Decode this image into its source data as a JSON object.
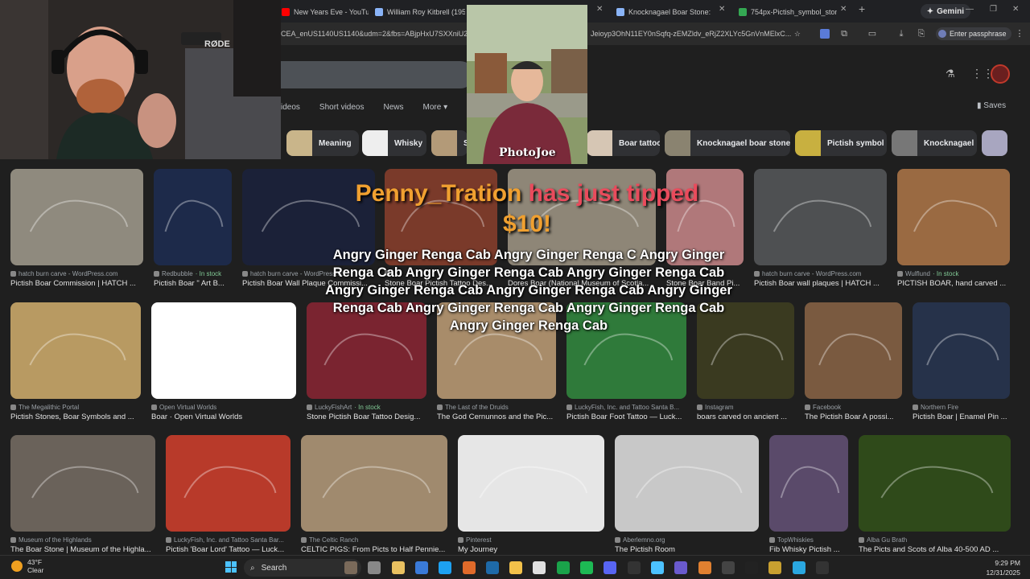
{
  "browser": {
    "tabs": [
      {
        "label": "New Years Eve - YouTub",
        "color": "#ff0000"
      },
      {
        "label": "William Roy Kitbrell (1959-2",
        "color": "#8ab4f8"
      },
      {
        "label": "Knocknagael Boar Stone: His",
        "color": "#8ab4f8"
      },
      {
        "label": "754px-Pictish_symbol_stone_",
        "color": "#34a853"
      }
    ],
    "gemini_label": "Gemini",
    "url": "CEA_enUS1140US1140&udm=2&fbs=ABjpHxU7SXXniU2",
    "url_tail": "Jeioyp3OhN11EY0nSqfq-zEMZldv_eRjZ2XLYc5GnVnMElxC...",
    "passphrase_label": "Enter passphrase"
  },
  "search": {
    "filters": [
      "ideos",
      "Short videos",
      "News",
      "More"
    ],
    "saves_label": "Saves",
    "chips": [
      {
        "label": "Meaning",
        "color": "#c9b58a"
      },
      {
        "label": "Whisky",
        "color": "#eee"
      },
      {
        "label": "S",
        "color": "#b39a78"
      },
      {
        "label": "Boar tattoo",
        "color": "#d6c6b4"
      },
      {
        "label": "Knocknagael boar stone",
        "color": "#8a8370"
      },
      {
        "label": "Pictish symbol",
        "color": "#c8b040"
      },
      {
        "label": "Knocknagael",
        "color": "#777"
      }
    ]
  },
  "results": [
    {
      "source": "hatch burn carve - WordPress.com",
      "title": "Pictish Boar Commission | HATCH ...",
      "color": "#8f8a7e",
      "stock": ""
    },
    {
      "source": "Redbubble",
      "title": "Pictish Boar \" Art B...",
      "color": "#1d2a4a",
      "stock": "In stock"
    },
    {
      "source": "hatch burn carve - WordPress.com",
      "title": "Pictish Boar Wall Plaque Commissi...",
      "color": "#1b2138",
      "stock": ""
    },
    {
      "source": "",
      "title": "Stone Boar Pictish Tattoo Des...",
      "color": "#7a3a2a",
      "stock": ""
    },
    {
      "source": "",
      "title": "Dores Boar (National Museum of Scotla...",
      "color": "#8e8677",
      "stock": ""
    },
    {
      "source": "",
      "title": "Stone Boar Band Pi...",
      "color": "#b0787a",
      "stock": ""
    },
    {
      "source": "hatch burn carve - WordPress.com",
      "title": "Pictish Boar wall plaques | HATCH ...",
      "color": "#4e5052",
      "stock": ""
    },
    {
      "source": "Wulflund",
      "title": "PICTISH BOAR, hand carved ...",
      "color": "#9a6a42",
      "stock": "In stock"
    },
    {
      "source": "The Megalithic Portal",
      "title": "Pictish Stones, Boar Symbols and ...",
      "color": "#b89a62",
      "stock": ""
    },
    {
      "source": "Open Virtual Worlds",
      "title": "Boar · Open Virtual Worlds",
      "color": "#ffffff",
      "stock": ""
    },
    {
      "source": "LuckyFishArt",
      "title": "Stone Pictish Boar Tattoo Desig...",
      "color": "#7a2430",
      "stock": "In stock"
    },
    {
      "source": "The Last of the Druids",
      "title": "The God Cernunnos and the Pic...",
      "color": "#a88c6a",
      "stock": ""
    },
    {
      "source": "LuckyFish, Inc. and Tattoo Santa B...",
      "title": "Pictish Boar Foot Tattoo — Luck...",
      "color": "#2f7a3a",
      "stock": ""
    },
    {
      "source": "Instagram",
      "title": "boars carved on ancient ...",
      "color": "#3a3a20",
      "stock": ""
    },
    {
      "source": "Facebook",
      "title": "The Pictish Boar A possi...",
      "color": "#7a5a40",
      "stock": ""
    },
    {
      "source": "Northern Fire",
      "title": "Pictish Boar | Enamel Pin ...",
      "color": "#26324a",
      "stock": ""
    },
    {
      "source": "Museum of the Highlands",
      "title": "The Boar Stone | Museum of the Highla...",
      "color": "#6a625a",
      "stock": ""
    },
    {
      "source": "LuckyFish, Inc. and Tattoo Santa Bar...",
      "title": "Pictish 'Boar Lord' Tattoo — Luck...",
      "color": "#b83a2a",
      "stock": ""
    },
    {
      "source": "The Celtic Ranch",
      "title": "CELTIC PIGS: From Picts to Half Pennie...",
      "color": "#a08a6e",
      "stock": ""
    },
    {
      "source": "Pinterest",
      "title": "My Journey",
      "color": "#e6e6e6",
      "stock": ""
    },
    {
      "source": "Aberlemno.org",
      "title": "The Pictish Room",
      "color": "#c8c8c8",
      "stock": ""
    },
    {
      "source": "TopWhiskies",
      "title": "Fib Whisky Pictish ...",
      "color": "#5a4a6a",
      "stock": ""
    },
    {
      "source": "Alba Gu Brath",
      "title": "The Picts and Scots of Alba 40-500 AD ...",
      "color": "#2f4a1a",
      "stock": ""
    }
  ],
  "overlay": {
    "tipper": "Penny_Tration",
    "tip_text": " has just tipped",
    "amount": "$10!",
    "message": "Angry Ginger Renga Cab Angry Ginger Renga C Angry Ginger Renga Cab Angry Ginger Renga Cab Angry Ginger Renga Cab Angry Ginger Renga Cab Angry Ginger Renga Cab Angry Ginger Renga Cab Angry Ginger Renga Cab Angry Ginger Renga Cab Angry Ginger Renga Cab",
    "cam2_tag": "PhotoJoe",
    "mic_label": "RØDE"
  },
  "taskbar": {
    "temp": "43°F",
    "condition": "Clear",
    "search_label": "Search",
    "time": "9:29 PM",
    "date": "12/31/2025"
  }
}
